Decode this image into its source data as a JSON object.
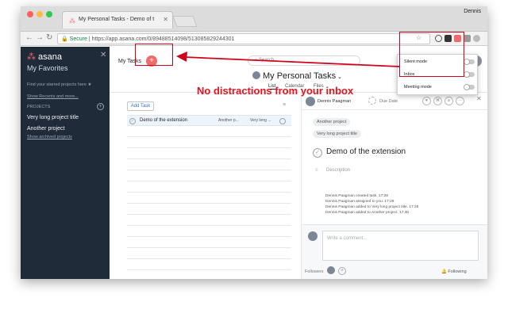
{
  "browser": {
    "tab_title": "My Personal Tasks - Demo of t",
    "user": "Dennis",
    "secure_label": "Secure",
    "url": "https://app.asana.com/0/89488514098/513085829244301"
  },
  "sidebar": {
    "logo": "asana",
    "favorites": "My Favorites",
    "hint": "Find your starred projects here",
    "recents_link": "Show Recents and more...",
    "projects_header": "PROJECTS",
    "projects": [
      "Very long project title",
      "Another project"
    ],
    "archived_link": "Show archived projects"
  },
  "topbar": {
    "my_tasks": "My Tasks",
    "search_placeholder": "Search",
    "page_title": "My Personal Tasks",
    "views": [
      "List",
      "Calendar",
      "Files"
    ]
  },
  "list": {
    "add_task": "Add Task",
    "task": {
      "name": "Demo of the extension",
      "tag1": "Another p...",
      "tag2": "Very long ..."
    }
  },
  "detail": {
    "assignee": "Dennis Paagman",
    "due": "Due Date",
    "projects": [
      "Another project",
      "Very long project title"
    ],
    "title": "Demo of the extension",
    "description_placeholder": "Description",
    "log": [
      "Dennis Paagman created task.   17:28",
      "Dennis Paagman assigned to you.   17:28",
      "Dennis Paagman added to Very long project title.   17:28",
      "Dennis Paagman added to Another project.   17:30"
    ],
    "comment_placeholder": "Write a comment...",
    "followers_label": "Followers",
    "following": "Following"
  },
  "popup": {
    "rows": [
      "Silent mode",
      "Inbox",
      "Meeting mode"
    ]
  },
  "annotation": {
    "caption": "No distractions from your inbox"
  },
  "colors": {
    "accent": "#f06a6a",
    "annotation_red": "#d0021b",
    "sidebar_bg": "#1f2b38"
  }
}
